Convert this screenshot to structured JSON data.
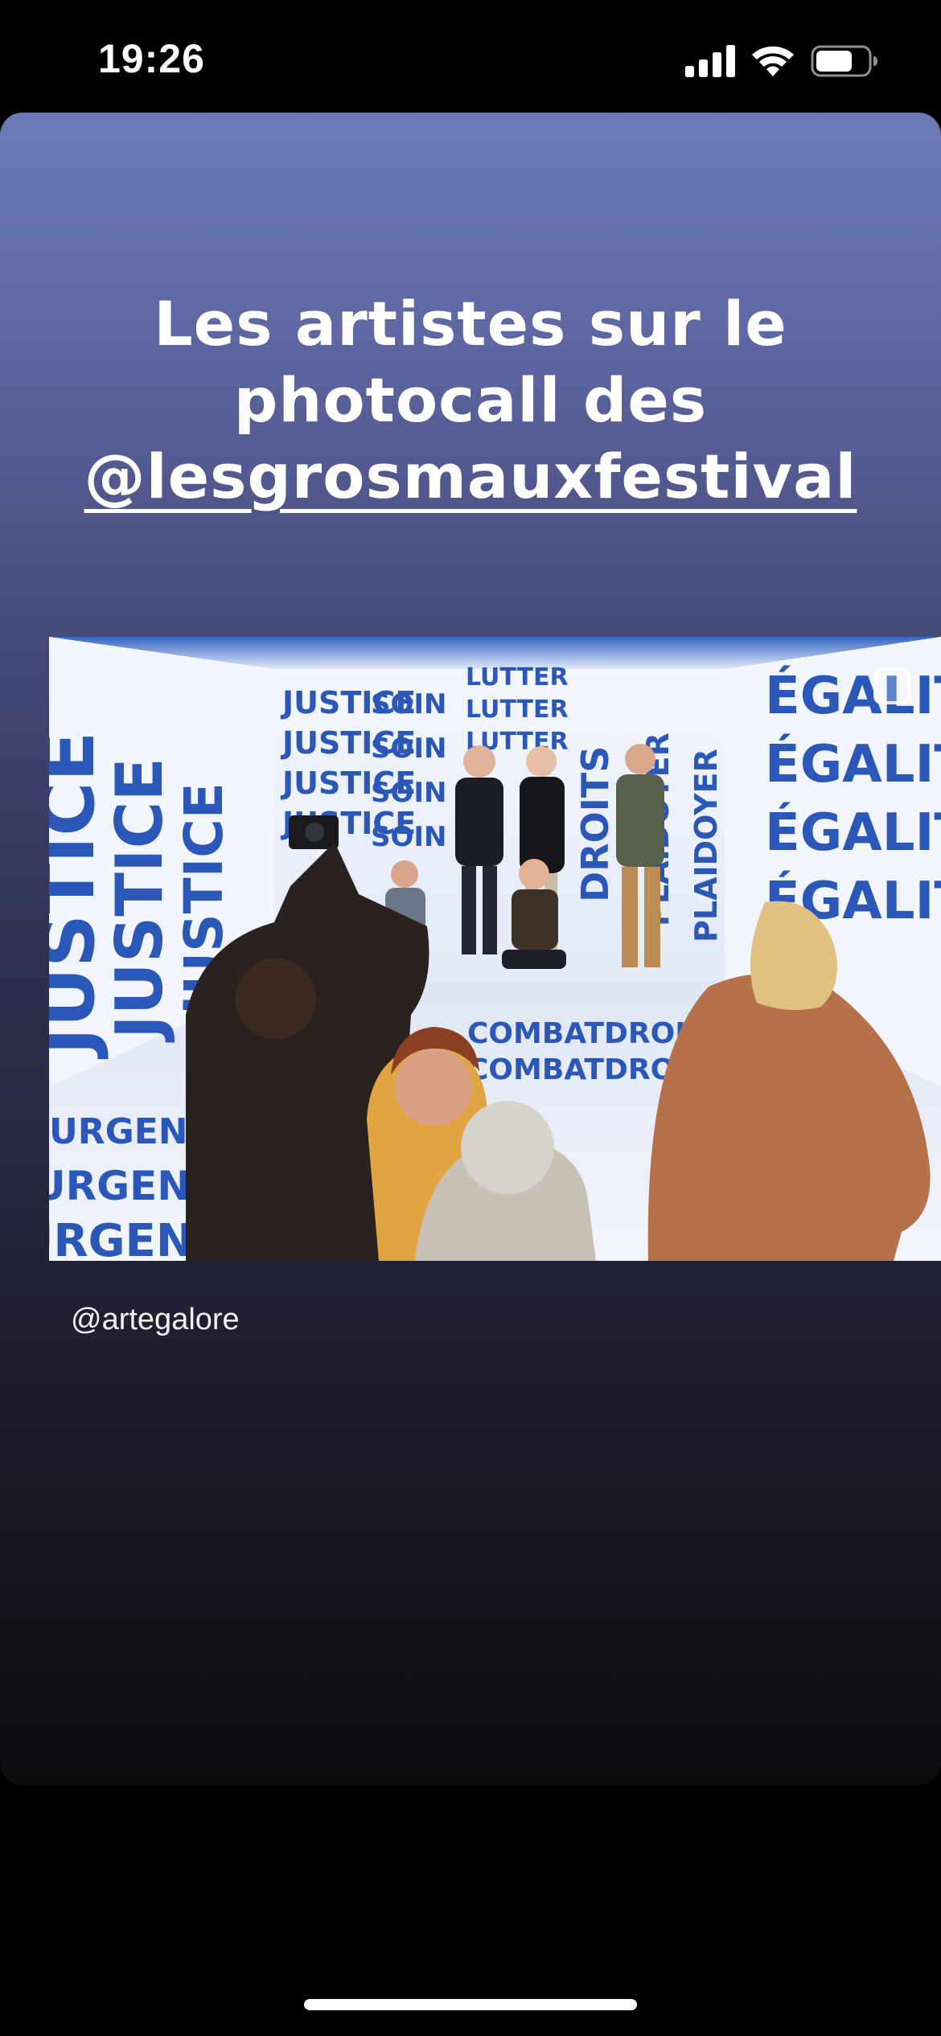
{
  "status_bar": {
    "time": "19:26",
    "signal_icon": "cellular-signal-icon",
    "wifi_icon": "wifi-icon",
    "battery_icon": "battery-icon"
  },
  "story": {
    "title_line1": "Les artistes sur le",
    "title_line2": "photocall des",
    "mention": "@lesgrosmauxfestival",
    "photo_credit": "@artegalore",
    "background_top_color": "#6c7ab6",
    "background_bottom_color": "#0d0b0e"
  },
  "photo": {
    "wall_words": {
      "justice": "JUSTICE",
      "soin": "SOIN",
      "lutter": "LUTTER",
      "droits": "DROITS",
      "plaidoyer": "PLAIDOYER",
      "egalite": "ÉGALITÉ",
      "urgence": "URGENCE",
      "combat": "COMBAT"
    },
    "text_color": "#2b58b8"
  }
}
